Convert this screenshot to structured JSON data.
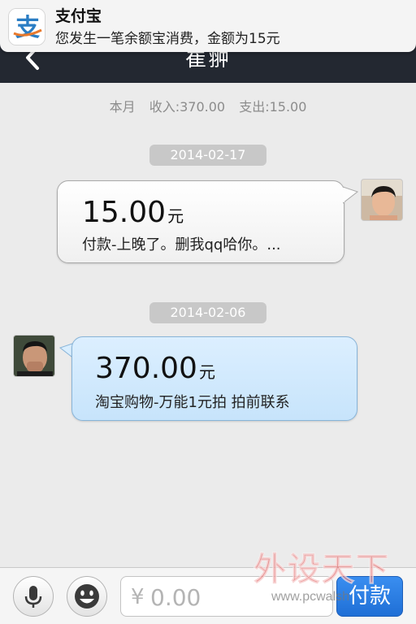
{
  "notification": {
    "app_name": "支付宝",
    "message": "您发生一笔余额宝消费，金额为15元",
    "icon": "alipay-logo-icon"
  },
  "navbar": {
    "title": "崔翀",
    "back_icon": "chevron-left-icon"
  },
  "summary": {
    "period": "本月",
    "income": "收入:370.00",
    "expense": "支出:15.00"
  },
  "transactions": [
    {
      "date": "2014-02-17",
      "direction": "outgoing",
      "amount": "15.00",
      "unit": "元",
      "memo": "付款-上晚了。删我qq哈你。..."
    },
    {
      "date": "2014-02-06",
      "direction": "incoming",
      "amount": "370.00",
      "unit": "元",
      "memo": "淘宝购物-万能1元拍 拍前联系"
    }
  ],
  "input_bar": {
    "voice_icon": "microphone-icon",
    "emoji_icon": "smiley-icon",
    "currency_symbol": "¥",
    "amount_placeholder": "0.00",
    "pay_label": "付款"
  },
  "watermark": {
    "text": "外设天下",
    "url": "www.pcwalsh"
  },
  "colors": {
    "navbar": "#232831",
    "background": "#ebebeb",
    "incoming_bubble": "#c7e4fb",
    "pay_button": "#1f6fd6"
  }
}
